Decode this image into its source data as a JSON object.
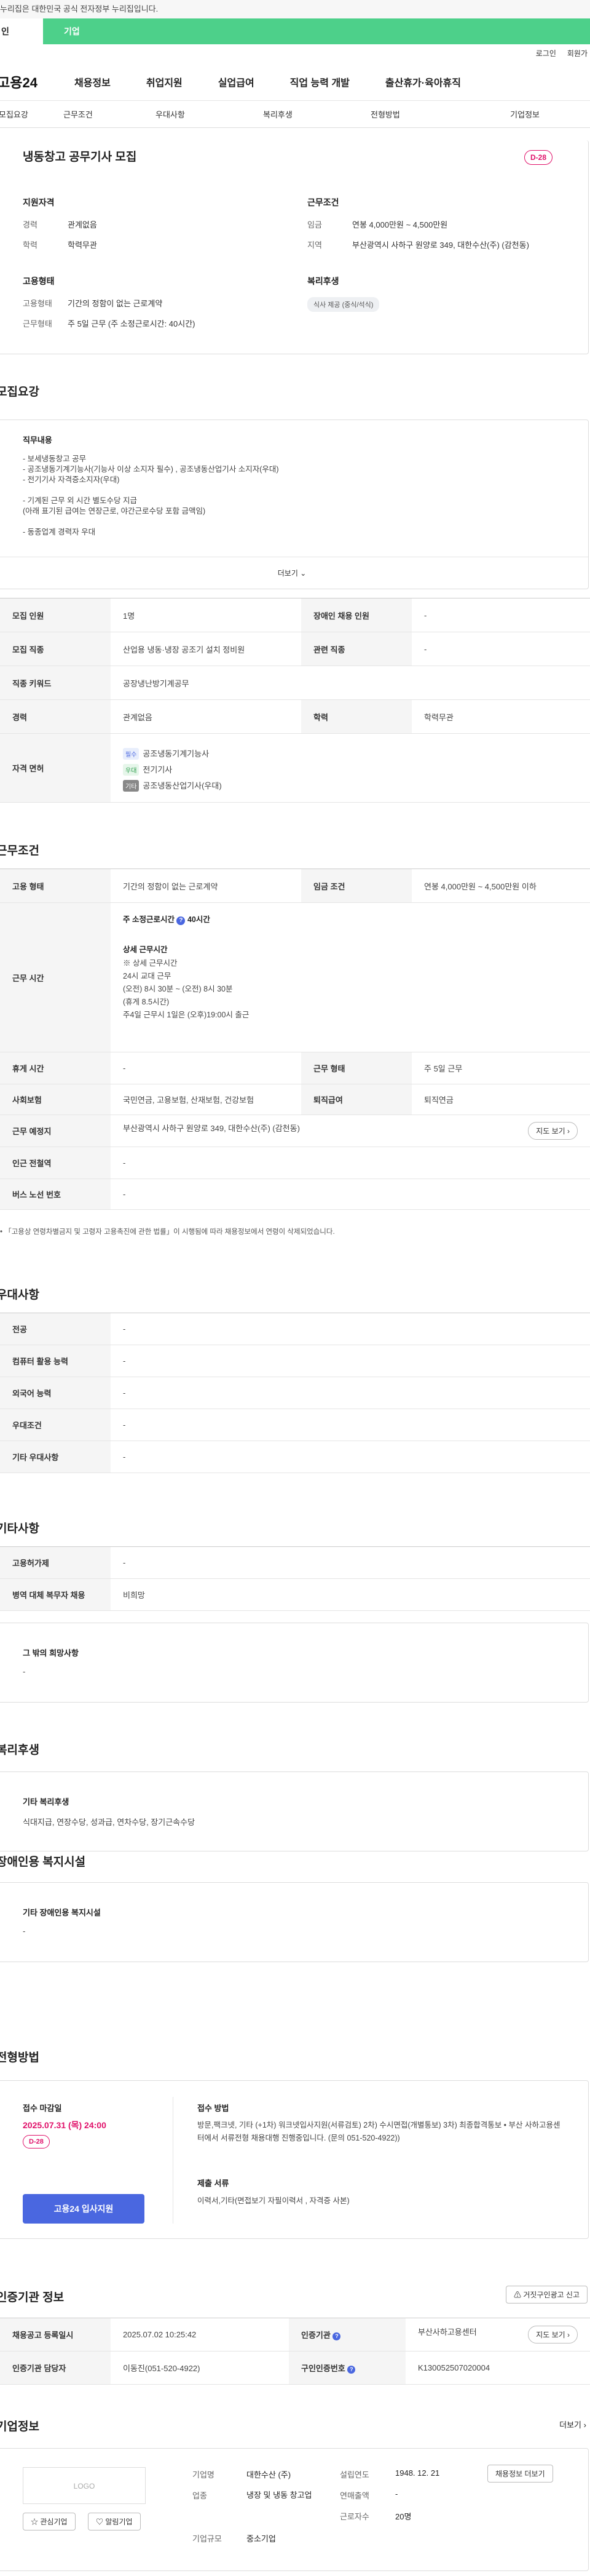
{
  "gov_notice": "누리집은 대한민국 공식 전자정부 누리집입니다.",
  "tabs": [
    "인",
    "기업"
  ],
  "util": [
    "로그인",
    "회원가"
  ],
  "logo": "고용24",
  "gnb": [
    "채용정보",
    "취업지원",
    "실업급여",
    "직업 능력 개발",
    "출산휴가·육아휴직"
  ],
  "snb": [
    "모집요강",
    "근무조건",
    "우대사항",
    "복리후생",
    "전형방법",
    "기업정보"
  ],
  "job": {
    "title": "냉동창고 공무기사 모집",
    "dday": "D-28",
    "qual_title": "지원자격",
    "exp_k": "경력",
    "exp_v": "관계없음",
    "edu_k": "학력",
    "edu_v": "학력무관",
    "cond_title": "근무조건",
    "wage_k": "임금",
    "wage_v": "연봉 4,000만원 ~ 4,500만원",
    "loc_k": "지역",
    "loc_v": "부산광역시 사하구 원양로 349, 대한수산(주) (감천동)",
    "emp_title": "고용형태",
    "type_k": "고용형태",
    "type_v": "기간의 정함이 없는 근로계약",
    "hours_k": "근무형태",
    "hours_v": "주 5일 근무 (주 소정근로시간: 40시간)",
    "welfare_title": "복리후생",
    "welfare_chip": "식사 제공 (중식/석식)"
  },
  "recruit": {
    "title": "모집요강",
    "duty_title": "직무내용",
    "duties": [
      "- 보세냉동창고 공무",
      "- 공조냉동기계기능사(기능사 이상 소지자 필수) , 공조냉동산업기사 소지자(우대)",
      "- 전기기사 자격증소지자(우대)",
      "",
      "- 기계된 근무 외 시간 별도수당 지급",
      "(아래 표기된 급여는 연장근로, 야간근로수당 포함 금액임)",
      "",
      "- 동종업계 경력자 우대"
    ],
    "more": "더보기",
    "rows": [
      [
        "모집 인원",
        "1명",
        "장애인 채용 인원",
        "-"
      ],
      [
        "모집 직종",
        "산업용 냉동·냉장 공조기 설치 정비원",
        "관련 직종",
        "-"
      ],
      [
        "직종 키워드",
        "공장냉난방기계공무",
        "",
        ""
      ],
      [
        "경력",
        "관계없음",
        "학력",
        "학력무관"
      ]
    ],
    "license_k": "자격 면허",
    "licenses": [
      {
        "tag": "필수",
        "name": "공조냉동기계기능사"
      },
      {
        "tag": "우대",
        "name": "전기기사"
      },
      {
        "tag": "기타",
        "name": "공조냉동산업기사(우대)"
      }
    ]
  },
  "work": {
    "title": "근무조건",
    "type_k": "고용 형태",
    "type_v": "기간의 정함이 없는 근로계약",
    "wage_k": "임금 조건",
    "wage_v": "연봉 4,000만원 ~ 4,500만원 이하",
    "time_k": "근무 시간",
    "time_head": "주 소정근로시간",
    "time_val": "40시간",
    "time_detail_title": "상세 근무시간",
    "time_detail": [
      "※ 상세 근무시간",
      "24시 교대 근무",
      "(오전) 8시 30분 ~ (오전) 8시 30분",
      "(휴게 8.5시간)",
      "주4일 근무시 1일은 (오후)19:00시 출근"
    ],
    "rest_k": "휴게 시간",
    "rest_v": "-",
    "shape_k": "근무 형태",
    "shape_v": "주 5일 근무",
    "ins_k": "사회보험",
    "ins_v": "국민연금, 고용보험, 산재보험, 건강보험",
    "sev_k": "퇴직급여",
    "sev_v": "퇴직연금",
    "place_k": "근무 예정지",
    "place_v": "부산광역시 사하구 원양로 349, 대한수산(주) (감천동)",
    "map_btn": "지도 보기",
    "sub_k": "인근 전철역",
    "sub_v": "-",
    "bus_k": "버스 노선 번호",
    "bus_v": "-",
    "note": "• 「고용상 연령차별금지 및 고령자 고용촉진에 관한 법률」이 시행됨에 따라 채용정보에서 연령이 삭제되었습니다."
  },
  "pref": {
    "title": "우대사항",
    "rows": [
      [
        "전공",
        "-"
      ],
      [
        "컴퓨터 활용 능력",
        "-"
      ],
      [
        "외국어 능력",
        "-"
      ],
      [
        "우대조건",
        "-"
      ],
      [
        "기타 우대사항",
        "-"
      ]
    ]
  },
  "etc": {
    "title": "기타사항",
    "rows": [
      [
        "고용허가제",
        "-"
      ],
      [
        "병역 대체 복무자 채용",
        "비희망"
      ]
    ],
    "box_title": "그 밖의 희망사항",
    "box_v": "-"
  },
  "welfare": {
    "title": "복리후생",
    "box_title": "기타 복리후생",
    "box_v": "식대지급, 연장수당, 성과급, 연차수당, 장기근속수당"
  },
  "disabled": {
    "title": "장애인용 복지시설",
    "box_title": "기타 장애인용 복지시설",
    "box_v": "-"
  },
  "screen": {
    "title": "전형방법",
    "deadline_k": "접수 마감일",
    "deadline_v": "2025.07.31 (목) 24:00",
    "dday": "D-28",
    "apply": "고용24 입사지원",
    "method_k": "접수 방법",
    "method_v": "방문,팩크넷, 기타 (+1차) 워크넷입사지원(서류검토) 2차) 수시면접(개별통보) 3차) 최종합격통보 • 부산 사하고용센터에서 서류전형 채용대행 진행중입니다. (문의 051-520-4922))",
    "docs_k": "제출 서류",
    "docs_v": "이력서,기타(면접보기 자필이력서 , 자격증 사본)"
  },
  "cert": {
    "title": "인증기관 정보",
    "report": "거짓구인광고 신고",
    "rows": [
      [
        "채용공고 등록일시",
        "2025.07.02 10:25:42",
        "인증기관",
        "부산사하고용센터"
      ],
      [
        "인증기관 담당자",
        "이동진(051-520-4922)",
        "구인인증번호",
        "K130052507020004"
      ]
    ],
    "map_btn": "지도 보기"
  },
  "company": {
    "title": "기업정보",
    "more": "더보기",
    "logo": "LOGO",
    "fav": "관심기업",
    "alarm": "알림기업",
    "info_btn": "채용정보 더보기",
    "f": [
      [
        "기업명",
        "대한수산 (주)",
        "설립연도",
        "1948. 12. 21"
      ],
      [
        "업종",
        "냉장 및 냉동 창고업",
        "연매출액",
        "-"
      ],
      [
        "",
        "",
        "근로자수",
        "20명"
      ],
      [
        "기업규모",
        "중소기업",
        "",
        ""
      ]
    ]
  }
}
